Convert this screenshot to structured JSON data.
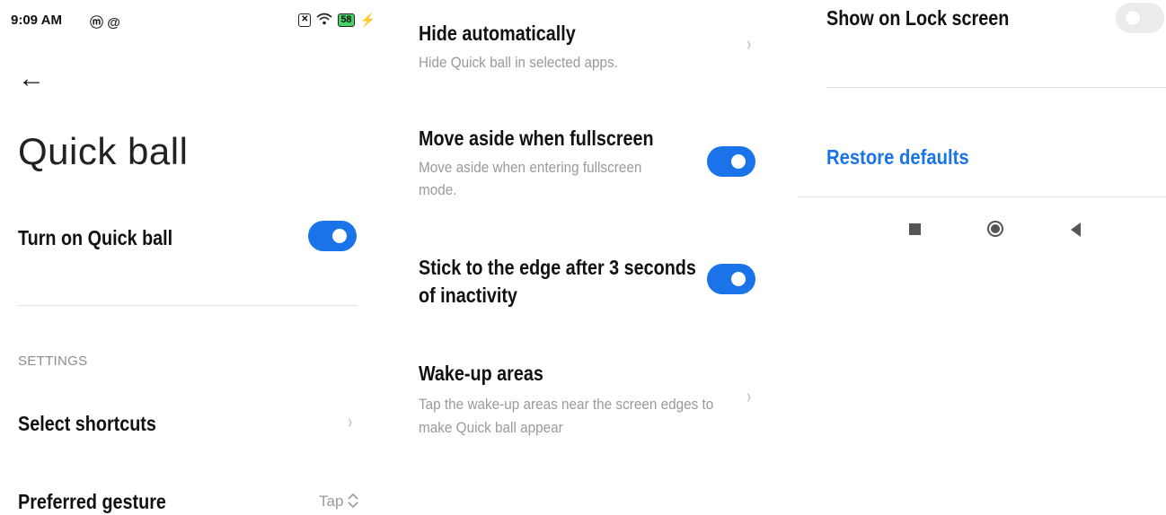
{
  "status_bar": {
    "time": "9:09 AM",
    "battery": "58",
    "notification_icons": [
      "m-icon",
      "at-icon"
    ]
  },
  "page": {
    "title": "Quick ball"
  },
  "settings": {
    "turn_on": {
      "label": "Turn on Quick ball",
      "enabled": true
    },
    "section_label": "SETTINGS",
    "select_shortcuts": {
      "label": "Select shortcuts"
    },
    "preferred_gesture": {
      "label": "Preferred gesture",
      "value": "Tap"
    },
    "hide_automatically": {
      "label": "Hide automatically",
      "description": "Hide Quick ball in selected apps."
    },
    "move_aside": {
      "label": "Move aside when fullscreen",
      "description_line1": "Move aside when entering fullscreen",
      "description_line2": "mode.",
      "enabled": true
    },
    "stick_edge": {
      "label_line1": "Stick to the edge after 3 seconds",
      "label_line2": "of inactivity",
      "enabled": true
    },
    "wake_up": {
      "label": "Wake-up areas",
      "description_line1": "Tap the wake-up areas near the screen edges to",
      "description_line2": "make Quick ball appear"
    },
    "lock_screen": {
      "label": "Show on Lock screen",
      "enabled": false
    },
    "restore_defaults": "Restore defaults"
  },
  "colors": {
    "accent": "#1a73e8",
    "toggle_off": "#ececec",
    "secondary_text": "#9a9a9a"
  }
}
